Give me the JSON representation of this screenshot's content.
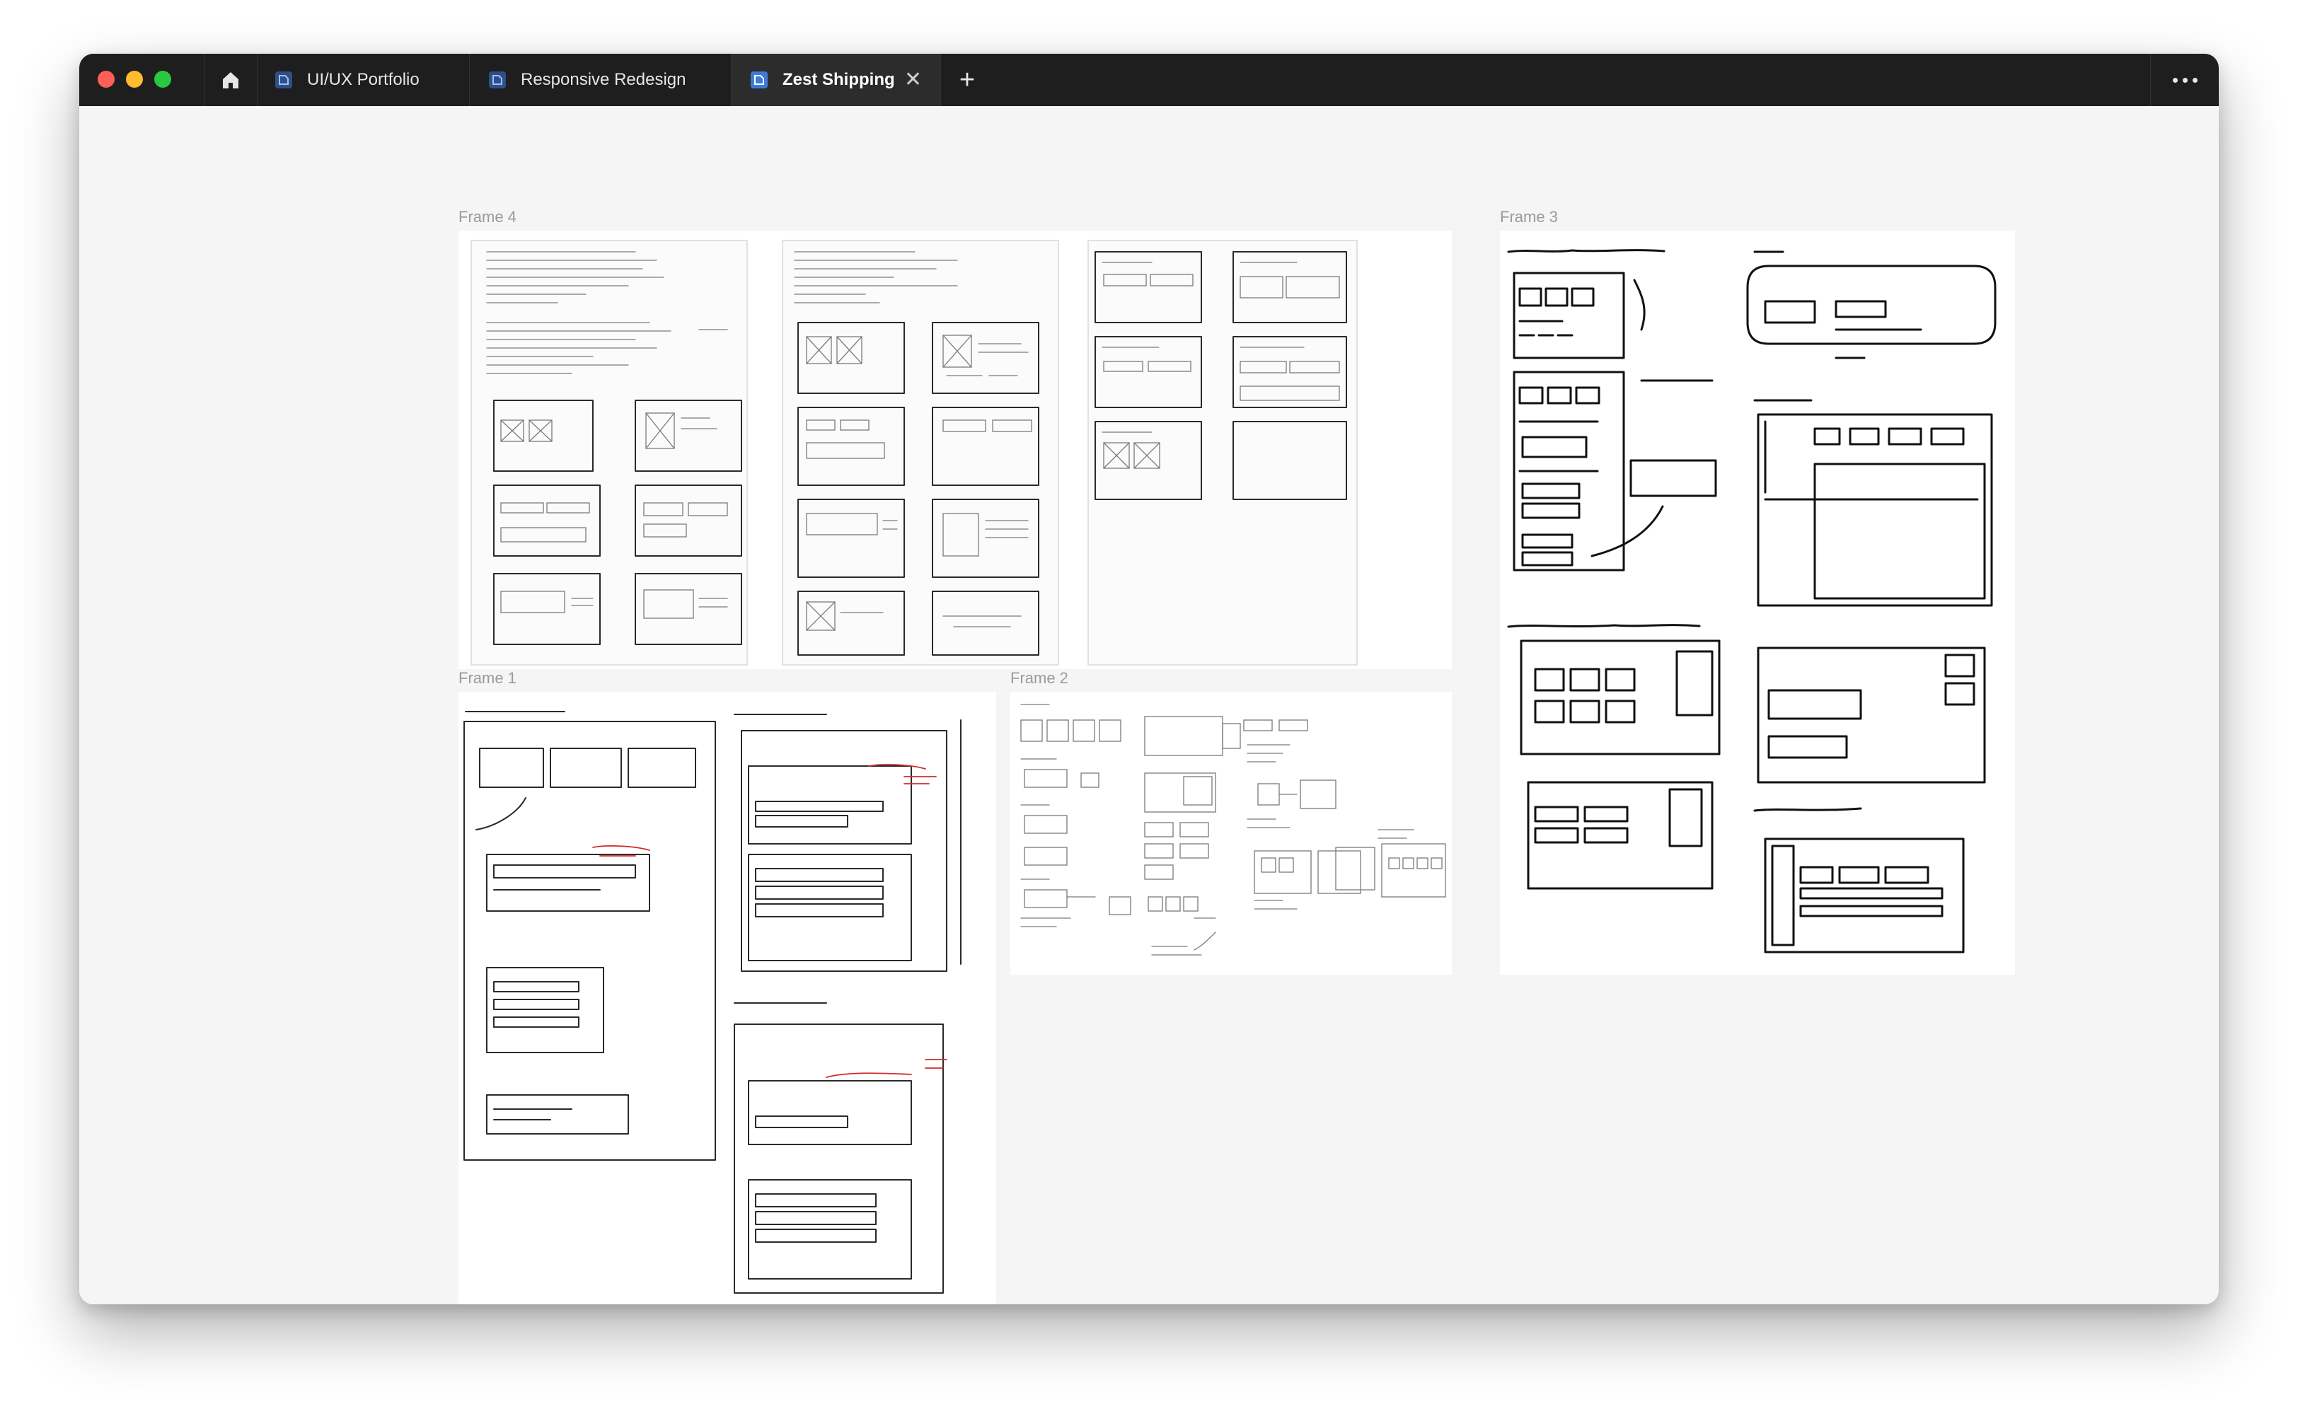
{
  "window": {
    "tabs": [
      {
        "label": "UI/UX Portfolio",
        "icon": "figma-file-icon",
        "active": false
      },
      {
        "label": "Responsive Redesign",
        "icon": "figma-file-icon",
        "active": false
      },
      {
        "label": "Zest Shipping",
        "icon": "figma-file-icon",
        "active": true
      }
    ],
    "home_icon": "home-icon",
    "new_tab_label": "+",
    "close_tab_label": "✕",
    "more_icon": "more-icon"
  },
  "canvas": {
    "frames": [
      {
        "label": "Frame 4"
      },
      {
        "label": "Frame 3"
      },
      {
        "label": "Frame 1"
      },
      {
        "label": "Frame 2"
      }
    ]
  },
  "colors": {
    "titlebar": "#1e1e1e",
    "canvas": "#f5f5f5",
    "active_tab": "#2c2c2c",
    "tab_icon": "#3d7bd9",
    "annotation_red": "#d22a2a"
  }
}
